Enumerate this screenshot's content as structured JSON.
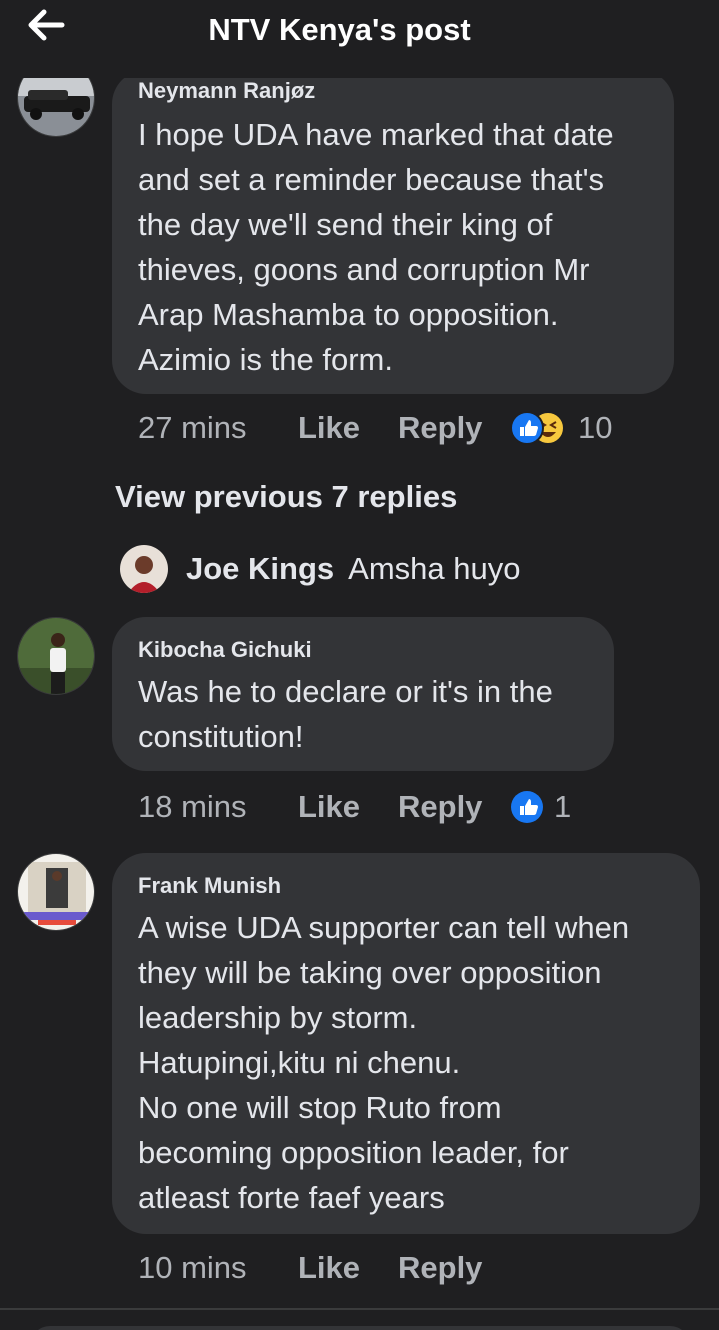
{
  "header": {
    "title": "NTV Kenya's post",
    "back_icon": "arrow-left-icon"
  },
  "comments": [
    {
      "author": "Neymann Ranjøz",
      "lines": [
        "I hope UDA have marked that date",
        "and set a reminder because that's",
        "the day we'll send their king of",
        "thieves, goons and corruption Mr",
        "Arap Mashamba to opposition.",
        "Azimio is the form."
      ],
      "time": "27 mins",
      "like": "Like",
      "reply": "Reply",
      "reaction_count": "10",
      "reactions": [
        "like-reaction-icon",
        "haha-reaction-icon"
      ]
    },
    {
      "author": "Kibocha Gichuki",
      "lines": [
        "Was he to declare or it's in the",
        "constitution!"
      ],
      "time": "18 mins",
      "like": "Like",
      "reply": "Reply",
      "reaction_count": "1",
      "reactions": [
        "like-reaction-icon"
      ]
    },
    {
      "author": "Frank Munish",
      "lines": [
        "A wise UDA supporter can tell when",
        "they will be taking over opposition",
        "leadership by storm.",
        "Hatupingi,kitu ni chenu.",
        "No one will stop Ruto from",
        "becoming opposition leader, for",
        "atleast forte faef years"
      ],
      "time": "10 mins",
      "like": "Like",
      "reply": "Reply"
    }
  ],
  "view_previous": "View previous 7 replies",
  "reply_preview": {
    "name": "Joe Kings",
    "text": "Amsha huyo"
  },
  "colors": {
    "background": "#1f1f21",
    "bubble": "#333437",
    "like_blue": "#1877f2",
    "haha_yellow": "#f7c83e"
  }
}
